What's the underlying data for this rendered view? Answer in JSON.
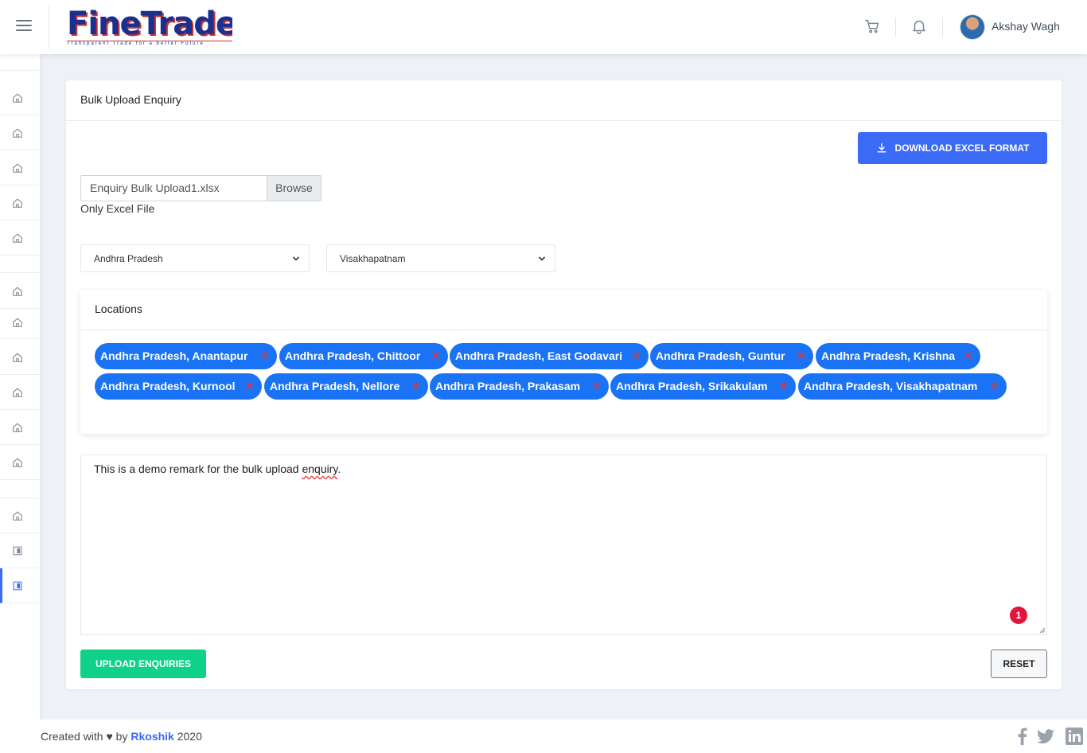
{
  "header": {
    "logo_text": "FineTrade",
    "logo_tagline": "Transparent Trade for a better Future",
    "user_name": "Akshay Wagh"
  },
  "sidebar": {
    "icons": [
      "home-icon",
      "home-icon",
      "home-icon",
      "home-icon",
      "home-icon",
      "home-icon",
      "home-icon",
      "home-icon",
      "home-icon",
      "home-icon",
      "home-icon",
      "home-icon",
      "panel-icon",
      "panel-icon"
    ],
    "active_index": 13
  },
  "page": {
    "title": "Bulk Upload Enquiry",
    "download_button": "DOWNLOAD EXCEL FORMAT",
    "file": {
      "name": "Enquiry Bulk Upload1.xlsx",
      "browse": "Browse",
      "help": "Only Excel File"
    },
    "state_select": "Andhra Pradesh",
    "city_select": "Visakhapatnam",
    "locations": {
      "title": "Locations",
      "chips": [
        "Andhra Pradesh, Anantapur",
        "Andhra Pradesh, Chittoor",
        "Andhra Pradesh, East Godavari",
        "Andhra Pradesh, Guntur",
        "Andhra Pradesh, Krishna",
        "Andhra Pradesh, Kurnool",
        "Andhra Pradesh, Nellore",
        "Andhra Pradesh, Prakasam",
        "Andhra Pradesh, Srikakulam",
        "Andhra Pradesh, Visakhapatnam"
      ],
      "remove_glyph": "✕"
    },
    "remark": {
      "text_before": "This is a demo remark for the bulk upload ",
      "text_flagged": "enquiry",
      "text_after": ".",
      "badge": "1"
    },
    "upload_button": "UPLOAD ENQUIRIES",
    "reset_button": "RESET"
  },
  "footer": {
    "prefix": "Created with ♥ by ",
    "brand": "Rkoshik",
    "year": " 2020"
  },
  "colors": {
    "accent": "#3b6af7",
    "chip": "#1a73f5",
    "success": "#0fd18a",
    "danger": "#e4153b"
  }
}
